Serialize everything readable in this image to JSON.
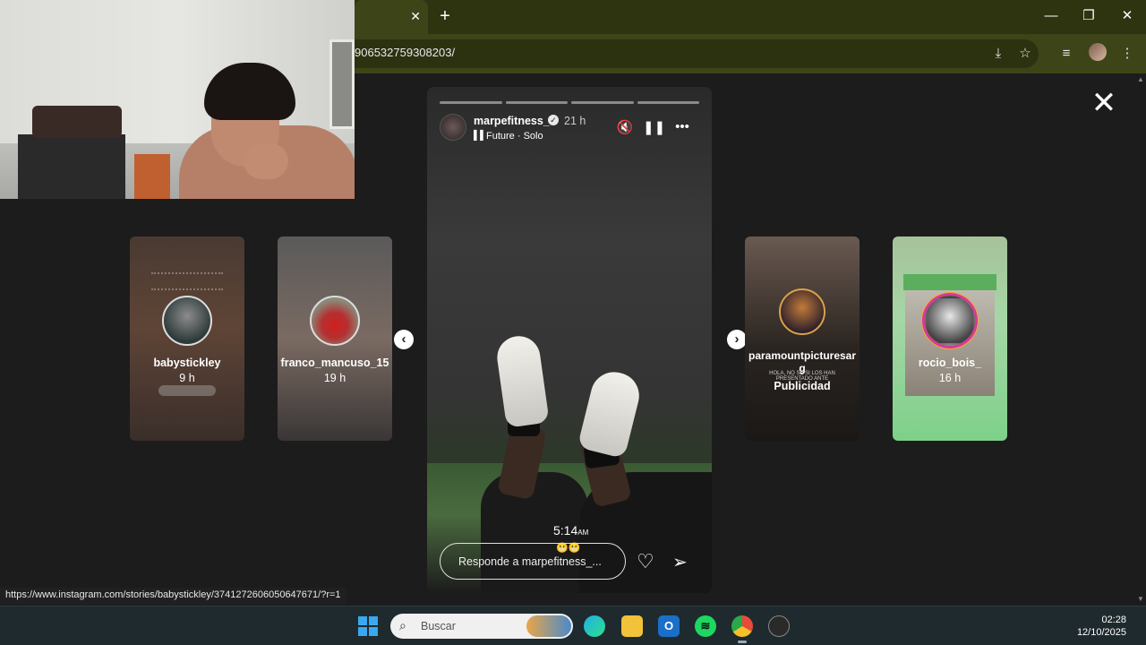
{
  "browser": {
    "url_fragment": "906532759308203/",
    "tab_close_glyph": "✕",
    "new_tab_glyph": "+",
    "window": {
      "minimize": "—",
      "restore": "❐",
      "close": "✕"
    }
  },
  "story": {
    "username": "marpefitness_",
    "time_ago": "21 h",
    "music": "Future · Solo",
    "clock_time": "5:14",
    "clock_suffix": "AM",
    "emoji": "😬😬",
    "reply_placeholder": "Responde a marpefitness_...",
    "progress_segments": 4
  },
  "side_stories": [
    {
      "username": "babystickley",
      "time": "9 h"
    },
    {
      "username": "franco_mancuso_15",
      "time": "19 h"
    },
    {
      "username": "paramountpicturesar\ng",
      "label": "Publicidad",
      "mini_text": "HOLA, NO SE SI LOS HAN PRESENTADO ANTE"
    },
    {
      "username": "rocio_bois_",
      "time": "16 h"
    }
  ],
  "close_glyph": "✕",
  "status_url": "https://www.instagram.com/stories/babystickley/3741272606050647671/?r=1",
  "taskbar": {
    "search_placeholder": "Buscar",
    "time": "02:28",
    "date": "12/10/2025"
  }
}
